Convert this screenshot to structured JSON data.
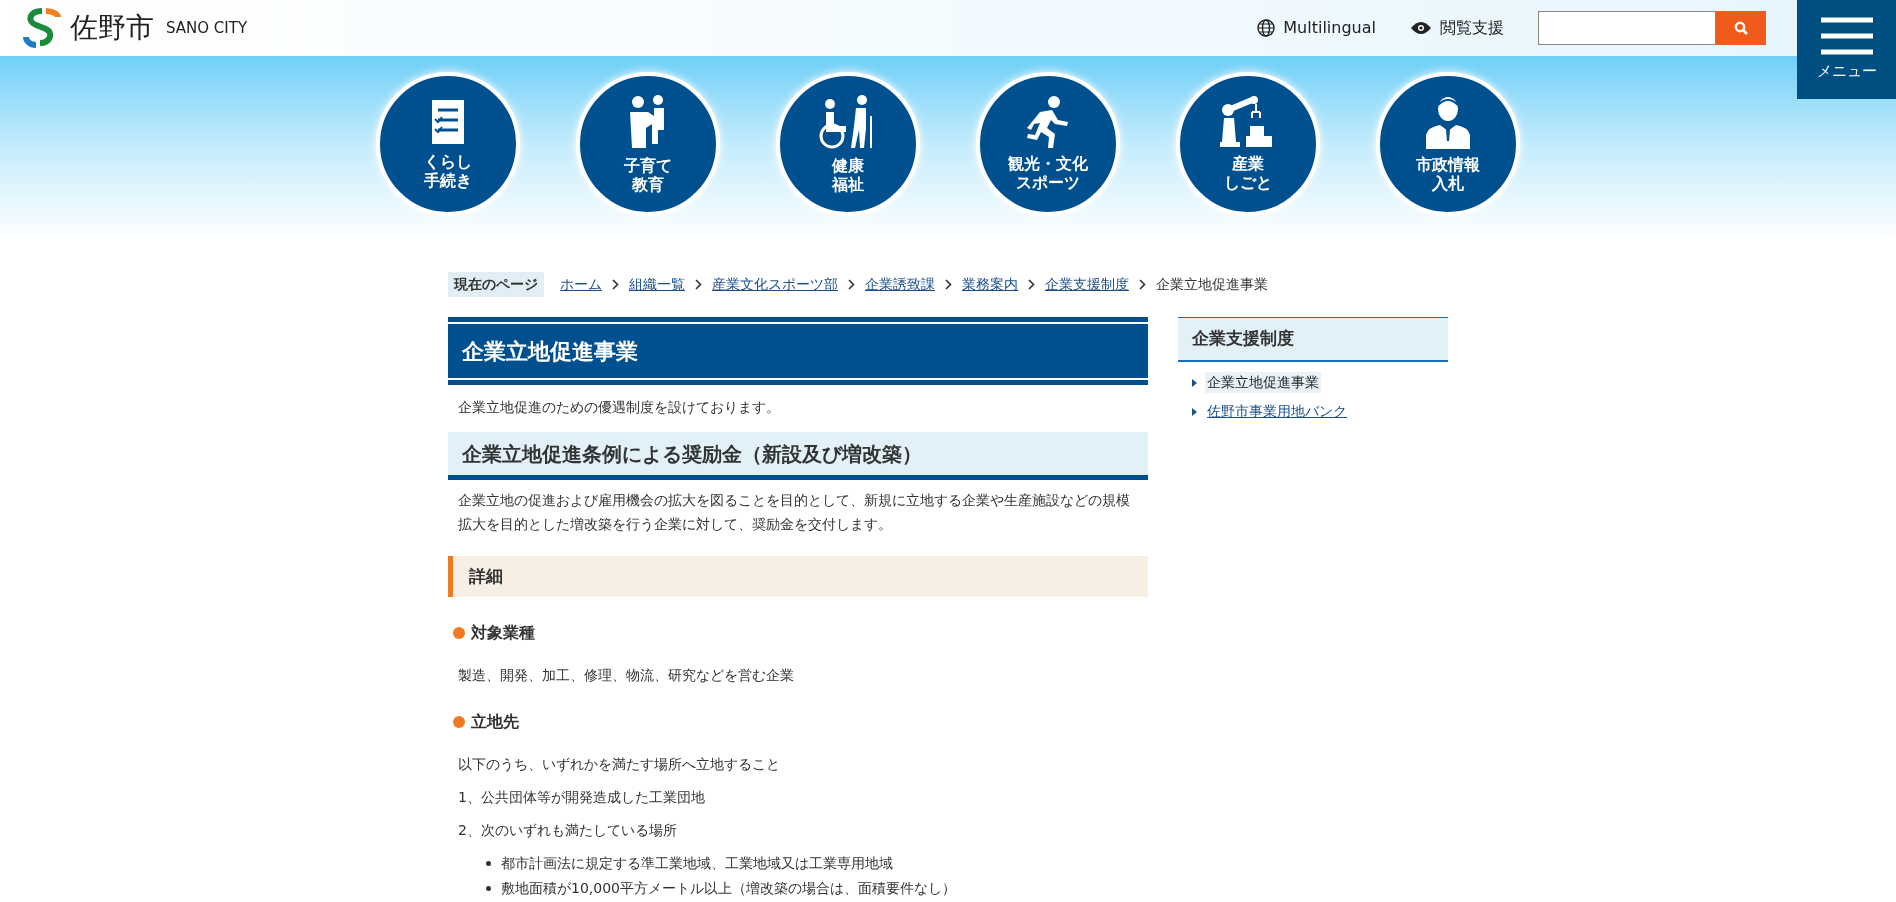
{
  "header": {
    "logo_text": "佐野市",
    "logo_sub": "SANO CITY",
    "multilingual": "Multilingual",
    "accessibility": "閲覧支援",
    "menu_label": "メニュー"
  },
  "categories": [
    {
      "kind": "checklist",
      "lines": [
        "くらし",
        "手続き"
      ]
    },
    {
      "kind": "childcare",
      "lines": [
        "子育て",
        "教育"
      ]
    },
    {
      "kind": "welfare",
      "lines": [
        "健康",
        "福祉"
      ]
    },
    {
      "kind": "runner",
      "lines": [
        "観光・文化",
        "スポーツ"
      ]
    },
    {
      "kind": "robot",
      "lines": [
        "産業",
        "しごと"
      ]
    },
    {
      "kind": "official",
      "lines": [
        "市政情報",
        "入札"
      ]
    }
  ],
  "breadcrumb": {
    "label": "現在のページ",
    "links": [
      "ホーム",
      "組織一覧",
      "産業文化スポーツ部",
      "企業誘致課",
      "業務案内",
      "企業支援制度"
    ],
    "current": "企業立地促進事業"
  },
  "main": {
    "title": "企業立地促進事業",
    "intro": "企業立地促進のための優遇制度を設けております。",
    "section_title": "企業立地促進条例による奨励金（新設及び増改築）",
    "section_text": "企業立地の促進および雇用機会の拡大を図ることを目的として、新規に立地する企業や生産施設などの規模拡大を目的とした増改築を行う企業に対して、奨励金を交付します。",
    "detail_title": "詳細",
    "items": [
      {
        "heading": "対象業種",
        "paragraphs": [
          "製造、開発、加工、修理、物流、研究などを営む企業"
        ]
      },
      {
        "heading": "立地先",
        "paragraphs": [
          "以下のうち、いずれかを満たす場所へ立地すること",
          "1、公共団体等が開発造成した工業団地",
          "2、次のいずれも満たしている場所"
        ],
        "bullets": [
          "都市計画法に規定する準工業地域、工業地域又は工業専用地域",
          "敷地面積が10,000平方メートル以上（増改築の場合は、面積要件なし）"
        ]
      }
    ]
  },
  "sidebar": {
    "title": "企業支援制度",
    "links": [
      {
        "label": "企業立地促進事業",
        "selected": true
      },
      {
        "label": "佐野市事業用地バンク",
        "selected": false
      }
    ]
  }
}
